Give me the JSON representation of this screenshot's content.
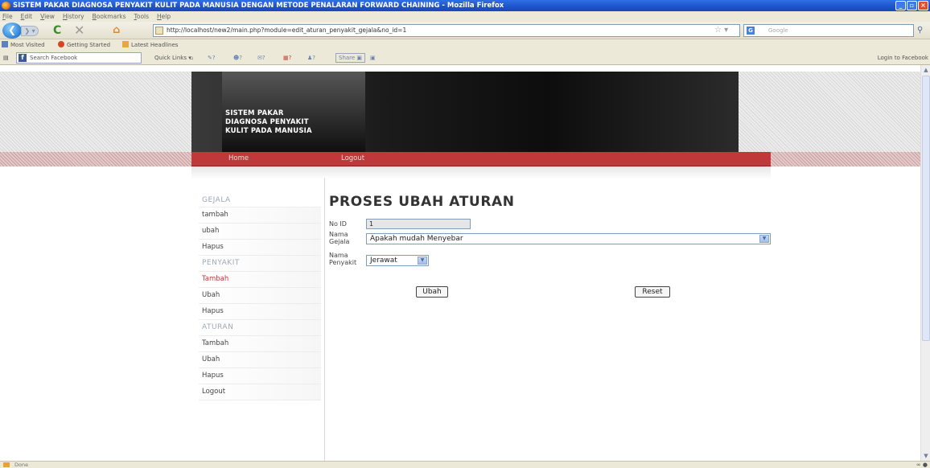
{
  "window": {
    "title": "SISTEM PAKAR DIAGNOSA PENYAKIT KULIT PADA MANUSIA DENGAN METODE PENALARAN FORWARD CHAINING - Mozilla Firefox"
  },
  "menu": [
    "File",
    "Edit",
    "View",
    "History",
    "Bookmarks",
    "Tools",
    "Help"
  ],
  "nav": {
    "url": "http://localhost/new2/main.php?module=edit_aturan_penyakit_gejala&no_id=1",
    "search_placeholder": "Google"
  },
  "bookmarks": [
    "Most Visited",
    "Getting Started",
    "Latest Headlines"
  ],
  "fb_toolbar": {
    "search_placeholder": "Search Facebook",
    "quick_links": "Quick Links",
    "share": "Share",
    "login": "Login to Facebook"
  },
  "site": {
    "title_lines": [
      "SISTEM PAKAR",
      "DIAGNOSA PENYAKIT",
      "KULIT PADA MANUSIA"
    ],
    "nav": [
      "Home",
      "Logout"
    ]
  },
  "sidebar": [
    {
      "label": "GEJALA",
      "type": "header"
    },
    {
      "label": "tambah",
      "type": "item"
    },
    {
      "label": "ubah",
      "type": "item"
    },
    {
      "label": "Hapus",
      "type": "item"
    },
    {
      "label": "PENYAKIT",
      "type": "header"
    },
    {
      "label": "Tambah",
      "type": "active"
    },
    {
      "label": "Ubah",
      "type": "item"
    },
    {
      "label": "Hapus",
      "type": "item"
    },
    {
      "label": "ATURAN",
      "type": "header"
    },
    {
      "label": "Tambah",
      "type": "item"
    },
    {
      "label": "Ubah",
      "type": "item"
    },
    {
      "label": "Hapus",
      "type": "item"
    },
    {
      "label": "Logout",
      "type": "item"
    }
  ],
  "form": {
    "title": "PROSES UBAH ATURAN",
    "no_id_label": "No ID",
    "no_id_value": "1",
    "gejala_label_1": "Nama",
    "gejala_label_2": "Gejala",
    "gejala_value": "Apakah mudah Menyebar",
    "penyakit_label_1": "Nama",
    "penyakit_label_2": "Penyakit",
    "penyakit_value": "Jerawat",
    "submit_label": "Ubah",
    "reset_label": "Reset"
  },
  "status": {
    "text": "Done"
  },
  "colors": {
    "accent_red": "#c0383a",
    "header_dark": "#111111",
    "titlebar_blue": "#1c54c8"
  }
}
